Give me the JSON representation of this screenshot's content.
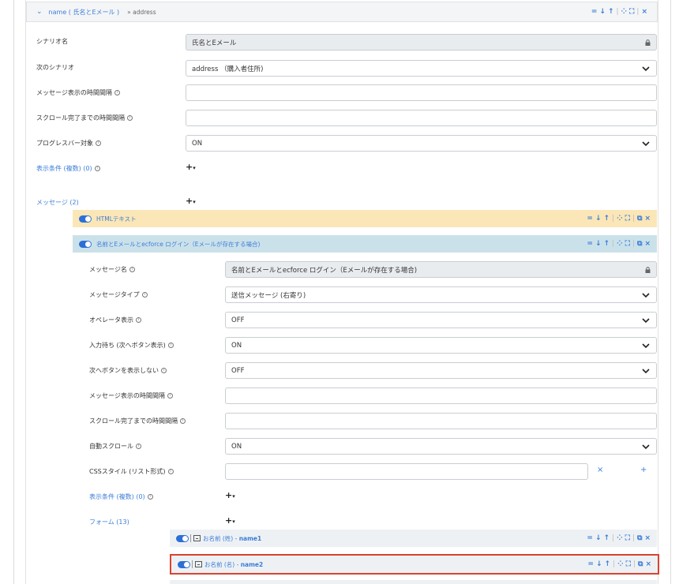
{
  "header": {
    "scenario_link": "name ( 氏名とEメール )",
    "next_link": "» address",
    "tools": {
      "menu": "=",
      "down": "↓",
      "up": "↑",
      "collapse": "⁘",
      "expand": "⛶",
      "close": "×"
    }
  },
  "scenario": {
    "name_label": "シナリオ名",
    "name_value": "氏名とEメール",
    "next_label": "次のシナリオ",
    "next_value": "address （購入者住所)",
    "msg_interval_label": "メッセージ表示の時間間隔",
    "msg_interval_value": "",
    "scroll_interval_label": "スクロール完了までの時間間隔",
    "scroll_interval_value": "",
    "progress_label": "プログレスバー対象",
    "progress_value": "ON",
    "conditions_label": "表示条件 (複数) (0)",
    "add_menu": "+",
    "add_menu_caret": "▾",
    "messages_label": "メッセージ (2)"
  },
  "messages": [
    {
      "title": "HTMLテキスト",
      "bg": "#fbe6b7"
    },
    {
      "title": "名前とEメールとecforce ログイン（Eメールが存在する場合)",
      "bg": "#cbe1ea"
    }
  ],
  "message_detail": {
    "name_label": "メッセージ名",
    "name_value": "名前とEメールとecforce ログイン（Eメールが存在する場合)",
    "type_label": "メッセージタイプ",
    "type_value": "送信メッセージ (右寄り)",
    "operator_label": "オペレータ表示",
    "operator_value": "OFF",
    "wait_label": "入力待ち (次へボタン表示)",
    "wait_value": "ON",
    "hide_next_label": "次へボタンを表示しない",
    "hide_next_value": "OFF",
    "msg_interval_label": "メッセージ表示の時間間隔",
    "msg_interval_value": "",
    "scroll_interval_label": "スクロール完了までの時間間隔",
    "scroll_interval_value": "",
    "autoscroll_label": "自動スクロール",
    "autoscroll_value": "ON",
    "css_label": "CSSスタイル (リスト形式)",
    "css_value": "",
    "css_clear": "×",
    "css_add": "+",
    "conditions_label": "表示条件 (複数) (0)",
    "forms_label": "フォーム (13)"
  },
  "forms": [
    {
      "label": "お名前 (姓) - ",
      "id": "name1"
    },
    {
      "label": "お名前 (名) - ",
      "id": "name2"
    }
  ],
  "colors": {
    "accent": "#3b7dd8",
    "highlight": "#d9432f",
    "form_row_bg": "#eef1f4"
  }
}
